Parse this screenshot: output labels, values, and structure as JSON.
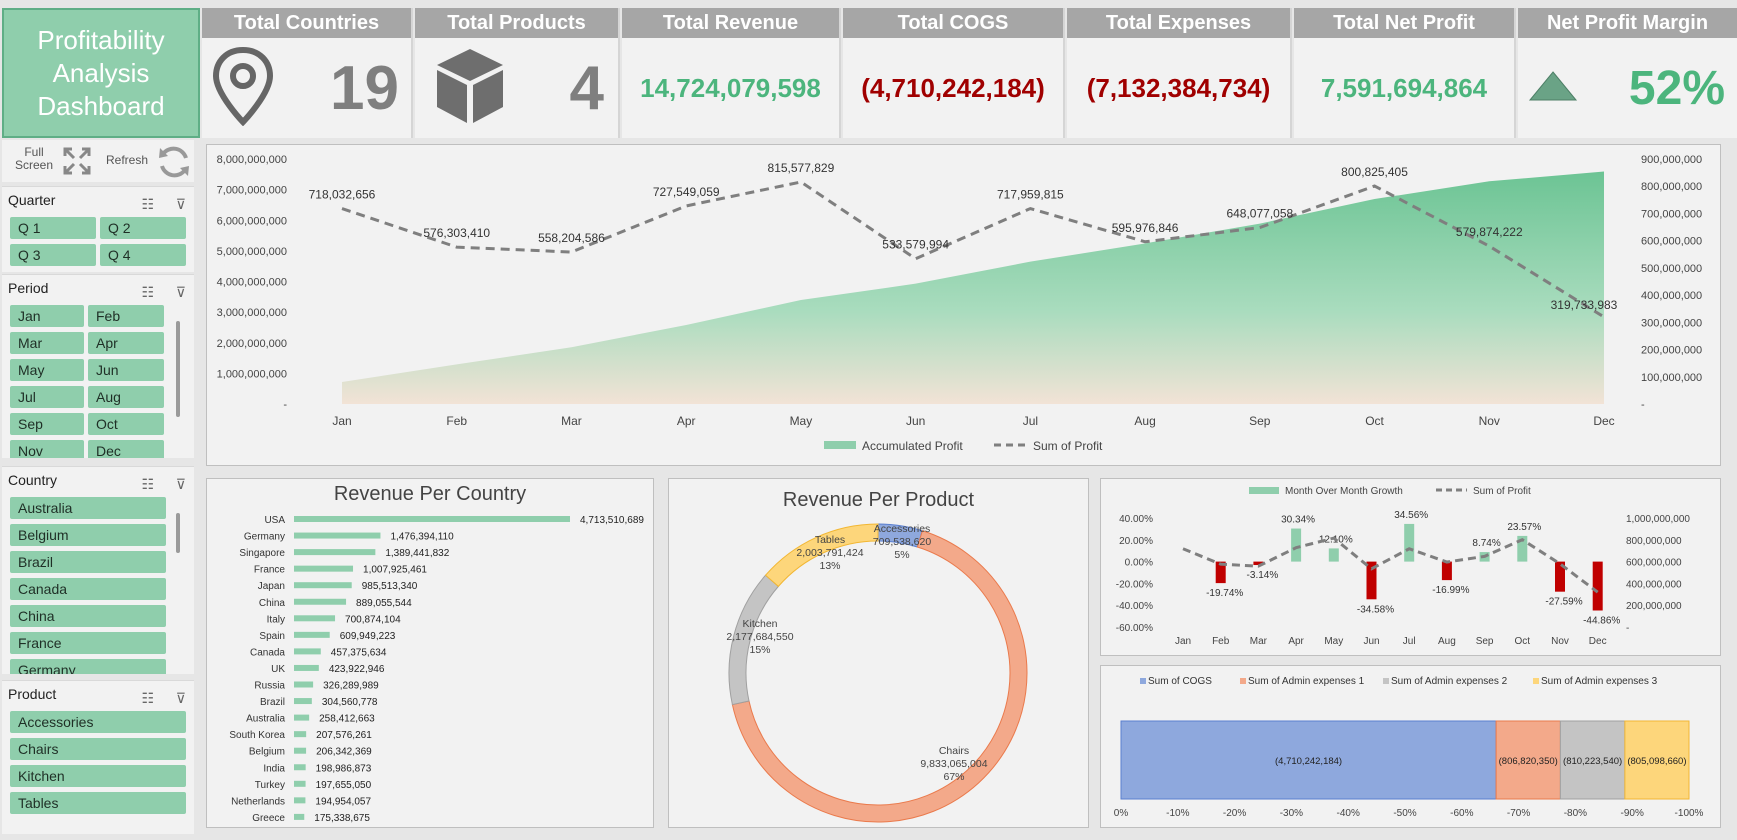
{
  "title": "Profitability Analysis Dashboard",
  "kpis": {
    "countries": {
      "label": "Total Countries",
      "value": "19"
    },
    "products": {
      "label": "Total Products",
      "value": "4"
    },
    "revenue": {
      "label": "Total Revenue",
      "value": "14,724,079,598"
    },
    "cogs": {
      "label": "Total COGS",
      "value": "(4,710,242,184)"
    },
    "expenses": {
      "label": "Total Expenses",
      "value": "(7,132,384,734)"
    },
    "net_profit": {
      "label": "Total Net Profit",
      "value": "7,591,694,864"
    },
    "margin": {
      "label": "Net Profit Margin",
      "value": "52%"
    }
  },
  "tools": {
    "fullscreen_label": "Full Screen",
    "refresh_label": "Refresh"
  },
  "slicers": {
    "quarter": {
      "label": "Quarter",
      "items": [
        "Q 1",
        "Q 2",
        "Q 3",
        "Q 4"
      ]
    },
    "period": {
      "label": "Period",
      "items": [
        "Jan",
        "Feb",
        "Mar",
        "Apr",
        "May",
        "Jun",
        "Jul",
        "Aug",
        "Sep",
        "Oct",
        "Nov",
        "Dec"
      ]
    },
    "country": {
      "label": "Country",
      "items": [
        "Australia",
        "Belgium",
        "Brazil",
        "Canada",
        "China",
        "France",
        "Germany"
      ]
    },
    "product": {
      "label": "Product",
      "items": [
        "Accessories",
        "Chairs",
        "Kitchen",
        "Tables"
      ]
    }
  },
  "colors": {
    "accent_green": "#8fceac",
    "value_green": "#4cb57d",
    "value_red": "#a00000",
    "header_gray": "#a6a6a6"
  },
  "icons": {
    "countries": "map-pin-icon",
    "products": "box-icon",
    "margin": "triangle-up-icon",
    "fullscreen": "expand-icon",
    "refresh": "refresh-icon",
    "filter_multi": "multi-select-icon",
    "filter_clear": "clear-filter-icon"
  },
  "chart_data": [
    {
      "type": "area",
      "categories": [
        "Jan",
        "Feb",
        "Mar",
        "Apr",
        "May",
        "Jun",
        "Jul",
        "Aug",
        "Sep",
        "Oct",
        "Nov",
        "Dec"
      ],
      "series": [
        {
          "name": "Accumulated Profit",
          "axis": "left",
          "values": [
            718032656,
            1294336066,
            1852540652,
            2580089711,
            3395667540,
            3929247534,
            4647207349,
            5243184195,
            5891261253,
            6692086658,
            7271960880,
            7591694863
          ]
        },
        {
          "name": "Sum of Profit",
          "axis": "right",
          "type": "line",
          "values": [
            718032656,
            576303410,
            558204586,
            727549059,
            815577829,
            533579994,
            717959815,
            595976846,
            648077058,
            800825405,
            579874222,
            319733983
          ],
          "labels": [
            "718,032,656",
            "576,303,410",
            "558,204,586",
            "727,549,059",
            "815,577,829",
            "533,579,994",
            "717,959,815",
            "595,976,846",
            "648,077,058",
            "800,825,405",
            "579,874,222",
            "319,733,983"
          ]
        }
      ],
      "ylim": [
        0,
        8000000000
      ],
      "y2lim": [
        0,
        900000000
      ],
      "yticks": [
        "8,000,000,000",
        "7,000,000,000",
        "6,000,000,000",
        "5,000,000,000",
        "4,000,000,000",
        "3,000,000,000",
        "2,000,000,000",
        "1,000,000,000",
        "-"
      ],
      "y2ticks": [
        "900,000,000",
        "800,000,000",
        "700,000,000",
        "600,000,000",
        "500,000,000",
        "400,000,000",
        "300,000,000",
        "200,000,000",
        "100,000,000",
        "-"
      ],
      "legend": "bottom"
    },
    {
      "type": "bar",
      "title": "Revenue Per Country",
      "categories": [
        "USA",
        "Germany",
        "Singapore",
        "France",
        "Japan",
        "China",
        "Italy",
        "Spain",
        "Canada",
        "UK",
        "Russia",
        "Brazil",
        "Australia",
        "South Korea",
        "Belgium",
        "India",
        "Turkey",
        "Netherlands",
        "Greece"
      ],
      "values": [
        4713510689,
        1476394110,
        1389441832,
        1007925461,
        985513340,
        889055544,
        700874104,
        609949223,
        457375634,
        423922946,
        326289989,
        304560778,
        258412663,
        207576261,
        206342369,
        198986873,
        197655050,
        194954057,
        175338675
      ],
      "labels": [
        "4,713,510,689",
        "1,476,394,110",
        "1,389,441,832",
        "1,007,925,461",
        "985,513,340",
        "889,055,544",
        "700,874,104",
        "609,949,223",
        "457,375,634",
        "423,922,946",
        "326,289,989",
        "304,560,778",
        "258,412,663",
        "207,576,261",
        "206,342,369",
        "198,986,873",
        "197,655,050",
        "194,954,057",
        "175,338,675"
      ]
    },
    {
      "type": "pie",
      "title": "Revenue Per Product",
      "categories": [
        "Accessories",
        "Chairs",
        "Kitchen",
        "Tables"
      ],
      "values": [
        709538620,
        9833065004,
        2177684550,
        2003791424
      ],
      "value_labels": [
        "709,538,620",
        "9,833,065,004",
        "2,177,684,550",
        "2,003,791,424"
      ],
      "percent_labels": [
        "5%",
        "67%",
        "15%",
        "13%"
      ]
    },
    {
      "type": "bar",
      "categories": [
        "Jan",
        "Feb",
        "Mar",
        "Apr",
        "May",
        "Jun",
        "Jul",
        "Aug",
        "Sep",
        "Oct",
        "Nov",
        "Dec"
      ],
      "series": [
        {
          "name": "Month Over Month Growth",
          "axis": "left",
          "values": [
            null,
            -19.74,
            -3.14,
            30.34,
            12.1,
            -34.58,
            34.56,
            -16.99,
            8.74,
            23.57,
            -27.59,
            -44.86
          ],
          "labels": [
            "",
            "-19.74%",
            "-3.14%",
            "30.34%",
            "12.10%",
            "-34.58%",
            "34.56%",
            "-16.99%",
            "8.74%",
            "23.57%",
            "-27.59%",
            "-44.86%"
          ]
        },
        {
          "name": "Sum of Profit",
          "axis": "right",
          "type": "line",
          "values": [
            718032656,
            576303410,
            558204586,
            727549059,
            815577829,
            533579994,
            717959815,
            595976846,
            648077058,
            800825405,
            579874222,
            319733983
          ]
        }
      ],
      "ylim": [
        -60,
        40
      ],
      "y2lim": [
        0,
        1000000000
      ],
      "yticks": [
        "40.00%",
        "20.00%",
        "0.00%",
        "-20.00%",
        "-40.00%",
        "-60.00%"
      ],
      "y2ticks": [
        "1,000,000,000",
        "800,000,000",
        "600,000,000",
        "400,000,000",
        "200,000,000",
        "-"
      ],
      "legend": "top"
    },
    {
      "type": "bar",
      "orientation": "horizontal-stacked",
      "series": [
        {
          "name": "Sum of COGS",
          "value": -4710242184,
          "label": "(4,710,242,184)"
        },
        {
          "name": "Sum of Admin expenses 1",
          "value": -806820350,
          "label": "(806,820,350)"
        },
        {
          "name": "Sum of Admin expenses 2",
          "value": -810223540,
          "label": "(810,223,540)"
        },
        {
          "name": "Sum of Admin expenses 3",
          "value": -805098660,
          "label": "(805,098,660)"
        }
      ],
      "xticks": [
        "0%",
        "-10%",
        "-20%",
        "-30%",
        "-40%",
        "-50%",
        "-60%",
        "-70%",
        "-80%",
        "-90%",
        "-100%"
      ],
      "legend": "top"
    }
  ]
}
